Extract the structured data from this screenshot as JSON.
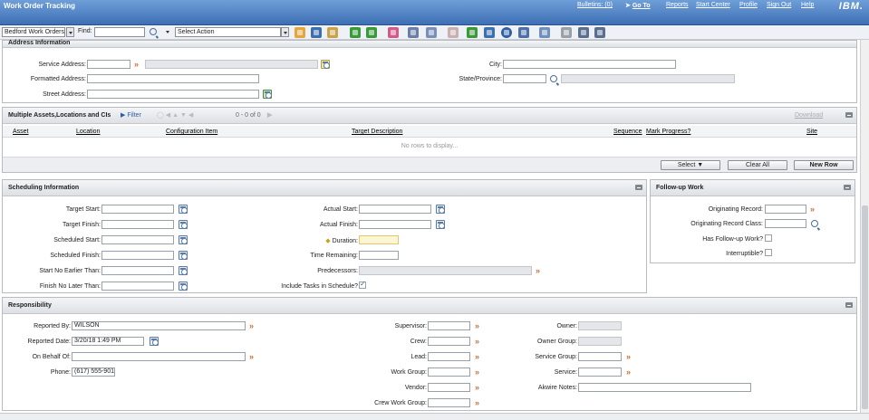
{
  "app": {
    "title": "Work Order Tracking",
    "links": [
      "Bulletins: (0)",
      "Go To",
      "Reports",
      "Start Center",
      "Profile",
      "Sign Out",
      "Help"
    ],
    "brand": "IBM."
  },
  "toolbar": {
    "query_value": "Bedford Work Orders",
    "find_label": "Find:",
    "find_value": "",
    "action_value": "Select Action",
    "icons": [
      "new-record",
      "save",
      "clear-changes",
      "previous-record",
      "next-record",
      "change-status",
      "route-workflow",
      "assign",
      "view-history",
      "approve",
      "barcode",
      "complete",
      "select-owner",
      "copy-template",
      "report",
      "print",
      "print-alt"
    ]
  },
  "address": {
    "title": "Address Information",
    "service_address_label": "Service Address:",
    "formatted_address_label": "Formatted Address:",
    "street_address_label": "Street Address:",
    "city_label": "City:",
    "state_label": "State/Province:"
  },
  "assets": {
    "title": "Multiple Assets,Locations and CIs",
    "filter_label": "Filter",
    "count": "0 - 0 of 0",
    "download_label": "Download",
    "columns": [
      "Asset",
      "Location",
      "Configuration Item",
      "Target Description",
      "Sequence",
      "Mark Progress?",
      "Site"
    ],
    "empty_text": "No rows to display...",
    "select_label": "Select",
    "clear_all_label": "Clear All",
    "new_row_label": "New Row"
  },
  "scheduling": {
    "title": "Scheduling Information",
    "target_start": "Target Start:",
    "target_finish": "Target Finish:",
    "scheduled_start": "Scheduled Start:",
    "scheduled_finish": "Scheduled Finish:",
    "start_no_earlier": "Start No Earlier Than:",
    "finish_no_later": "Finish No Later Than:",
    "actual_start": "Actual Start:",
    "actual_finish": "Actual Finish:",
    "duration": "Duration:",
    "time_remaining": "Time Remaining:",
    "predecessors": "Predecessors:",
    "include_tasks": "Include Tasks in Schedule?",
    "include_tasks_checked": true
  },
  "followup": {
    "title": "Follow-up Work",
    "originating_record": "Originating Record:",
    "originating_record_class": "Originating Record Class:",
    "has_followup": "Has Follow-up Work?",
    "interruptible": "Interruptible?"
  },
  "responsibility": {
    "title": "Responsibility",
    "reported_by_label": "Reported By:",
    "reported_by": "WILSON",
    "reported_date_label": "Reported Date:",
    "reported_date": "3/20/18 1:49 PM",
    "on_behalf_label": "On Behalf Of:",
    "phone_label": "Phone:",
    "phone": "(617) 555-9017",
    "supervisor_label": "Supervisor:",
    "crew_label": "Crew:",
    "lead_label": "Lead:",
    "work_group_label": "Work Group:",
    "vendor_label": "Vendor:",
    "crew_work_group_label": "Crew Work Group:",
    "owner_label": "Owner:",
    "owner_group_label": "Owner Group:",
    "service_group_label": "Service Group:",
    "service_label": "Service:",
    "akwire_label": "Akwire Notes:"
  },
  "colors": {
    "header": "#3d6fb5",
    "accent": "#2b5fa6",
    "required": "#fdf5d8"
  }
}
